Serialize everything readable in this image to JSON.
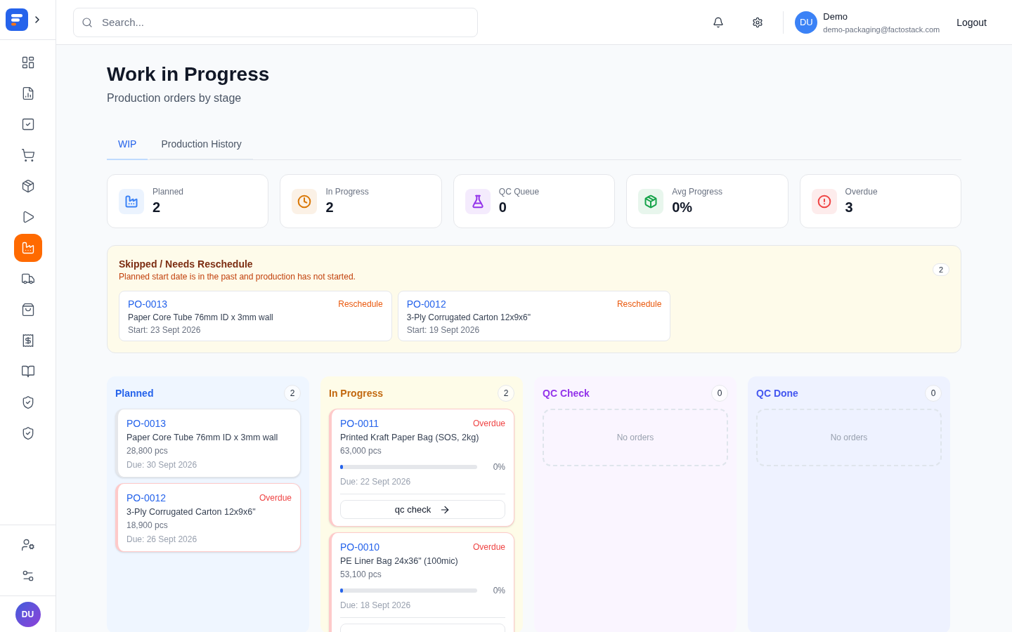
{
  "sidebar": {
    "nav_items": [
      {
        "selected": false
      },
      {
        "selected": false
      },
      {
        "selected": false
      },
      {
        "selected": false
      },
      {
        "selected": false
      },
      {
        "selected": false
      },
      {
        "selected": true
      },
      {
        "selected": false
      },
      {
        "selected": false
      },
      {
        "selected": false
      },
      {
        "selected": false
      },
      {
        "selected": false
      },
      {
        "selected": false
      }
    ],
    "user_initials": "DU"
  },
  "header": {
    "search": {
      "placeholder": "Search..."
    },
    "user": {
      "initials": "DU",
      "name": "Demo",
      "email": "demo-packaging@factostack.com"
    },
    "logout": "Logout"
  },
  "page": {
    "title": "Work in Progress",
    "subtitle": "Production orders by stage"
  },
  "tabs": [
    {
      "label": "WIP",
      "selected": true
    },
    {
      "label": "Production History",
      "selected": false
    }
  ],
  "summary_cards": [
    {
      "label": "Planned",
      "value": "2",
      "color": "#3b82f6"
    },
    {
      "label": "In Progress",
      "value": "2",
      "color": "#d97706"
    },
    {
      "label": "QC Queue",
      "value": "0",
      "color": "#9333ea"
    },
    {
      "label": "Avg Progress",
      "value": "0%",
      "color": "#16a34a"
    },
    {
      "label": "Overdue",
      "value": "3",
      "color": "#ef4444"
    }
  ],
  "reschedule": {
    "title": "Skipped / Needs Reschedule",
    "description": "Planned start date is in the past and production has not started.",
    "count": "2",
    "orders": [
      {
        "id": "PO-0013",
        "action": "Reschedule",
        "name": "Paper Core Tube 76mm ID x 3mm wall",
        "start": "Start: 23 Sept 2026"
      },
      {
        "id": "PO-0012",
        "action": "Reschedule",
        "name": "3-Ply Corrugated Carton 12x9x6\"",
        "start": "Start: 19 Sept 2026"
      }
    ]
  },
  "board": {
    "columns": [
      {
        "kind": "planned",
        "title": "Planned",
        "color": "#2563eb",
        "count": "2",
        "orders": [
          {
            "id": "PO-0013",
            "overdue": false,
            "name": "Paper Core Tube 76mm ID x 3mm wall",
            "quantity": "28,800 pcs",
            "due": "Due: 30 Sept 2026"
          },
          {
            "id": "PO-0012",
            "flag": "Overdue",
            "overdue": true,
            "name": "3-Ply Corrugated Carton 12x9x6\"",
            "quantity": "18,900 pcs",
            "due": "Due: 26 Sept 2026"
          }
        ]
      },
      {
        "kind": "in_progress",
        "title": "In Progress",
        "color": "#c2680f",
        "count": "2",
        "orders": [
          {
            "id": "PO-0011",
            "flag": "Overdue",
            "overdue": true,
            "name": "Printed Kraft Paper Bag (SOS, 2kg)",
            "quantity": "63,000 pcs",
            "level": 0,
            "reading": "0%",
            "due": "Due: 22 Sept 2026",
            "action_button": true,
            "action": "qc check"
          },
          {
            "id": "PO-0010",
            "flag": "Overdue",
            "overdue": true,
            "name": "PE Liner Bag 24x36\" (100mic)",
            "quantity": "53,100 pcs",
            "level": 0,
            "reading": "0%",
            "due": "Due: 18 Sept 2026",
            "action_button": true
          }
        ]
      },
      {
        "kind": "qc_check",
        "title": "QC Check",
        "color": "#9333ea",
        "count": "0",
        "empty_text": "No orders"
      },
      {
        "kind": "qc_done",
        "title": "QC Done",
        "color": "#4457f0",
        "count": "0",
        "empty_text": "No orders"
      }
    ]
  }
}
